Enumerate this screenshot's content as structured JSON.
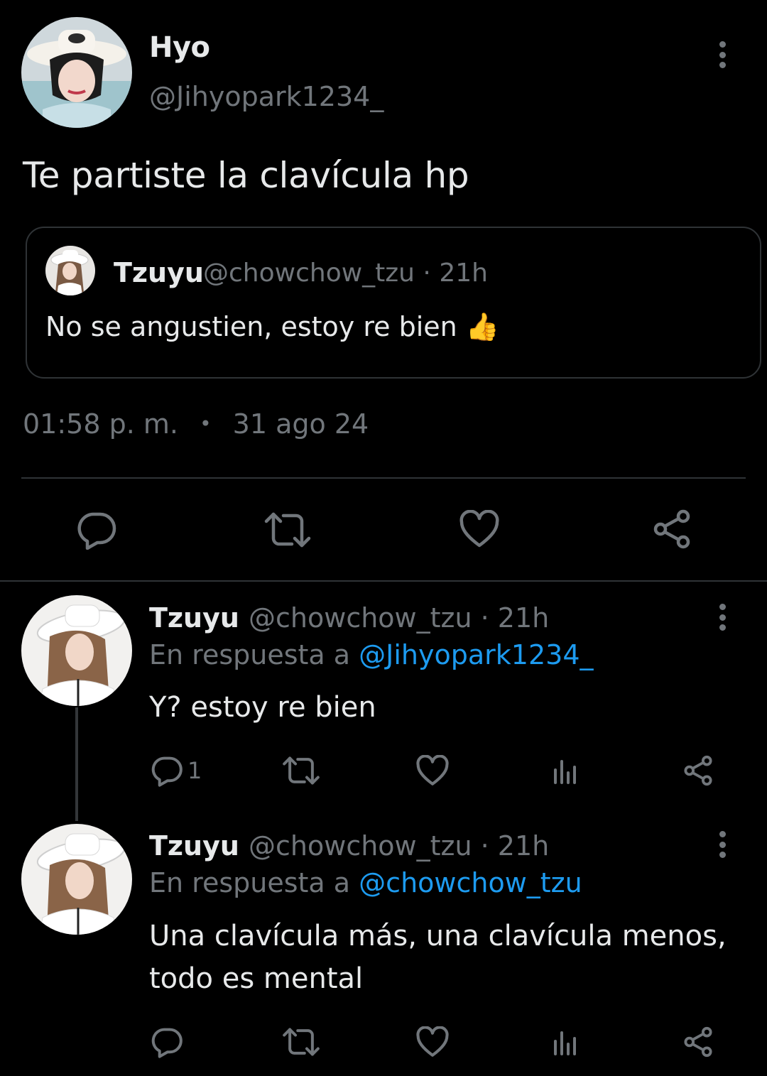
{
  "main_tweet": {
    "author_name": "Hyo",
    "author_handle": "@Jihyopark1234_",
    "text": "Te partiste la clavícula hp",
    "time": "01:58 p. m.",
    "separator": "•",
    "date": "31 ago 24"
  },
  "quoted_tweet": {
    "author_name": "Tzuyu",
    "author_handle": "@chowchow_tzu · 21h",
    "text": "No se angustien, estoy re bien 👍"
  },
  "replies": [
    {
      "author_name": "Tzuyu",
      "author_handle": "@chowchow_tzu · 21h",
      "reply_prefix": "En respuesta a",
      "reply_to": "@Jihyopark1234_",
      "text": "Y? estoy re bien",
      "reply_count": "1"
    },
    {
      "author_name": "Tzuyu",
      "author_handle": "@chowchow_tzu · 21h",
      "reply_prefix": "En respuesta a",
      "reply_to": "@chowchow_tzu",
      "text_line1": "Una clavícula más, una clavícula menos,",
      "text_line2": "todo es mental",
      "reply_count": ""
    }
  ],
  "icons": {
    "reply": "reply-icon",
    "retweet": "retweet-icon",
    "like": "heart-icon",
    "views": "views-icon",
    "share": "share-icon",
    "more": "more-icon"
  },
  "colors": {
    "background": "#000000",
    "text": "#e7e9ea",
    "muted": "#71767b",
    "link": "#1d9bf0",
    "border": "#2f3336"
  }
}
